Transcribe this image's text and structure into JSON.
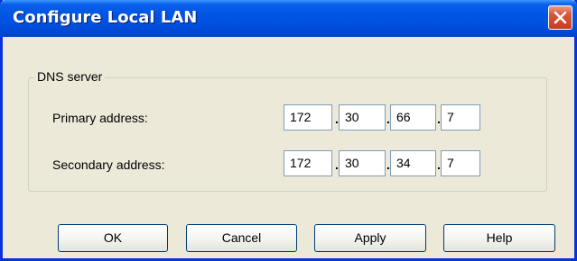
{
  "window": {
    "title": "Configure Local LAN"
  },
  "dns": {
    "group_label": "DNS server",
    "primary": {
      "label": "Primary address:",
      "octets": [
        "172",
        "30",
        "66",
        "7"
      ]
    },
    "secondary": {
      "label": "Secondary address:",
      "octets": [
        "172",
        "30",
        "34",
        "7"
      ]
    },
    "separator": "."
  },
  "buttons": {
    "ok": "OK",
    "cancel": "Cancel",
    "apply": "Apply",
    "help": "Help"
  },
  "icons": {
    "close": "close-icon"
  },
  "colors": {
    "titlebar": "#0054e3",
    "window_bg": "#ece9d8",
    "close_button": "#d9573a",
    "input_border": "#7f9db9"
  }
}
